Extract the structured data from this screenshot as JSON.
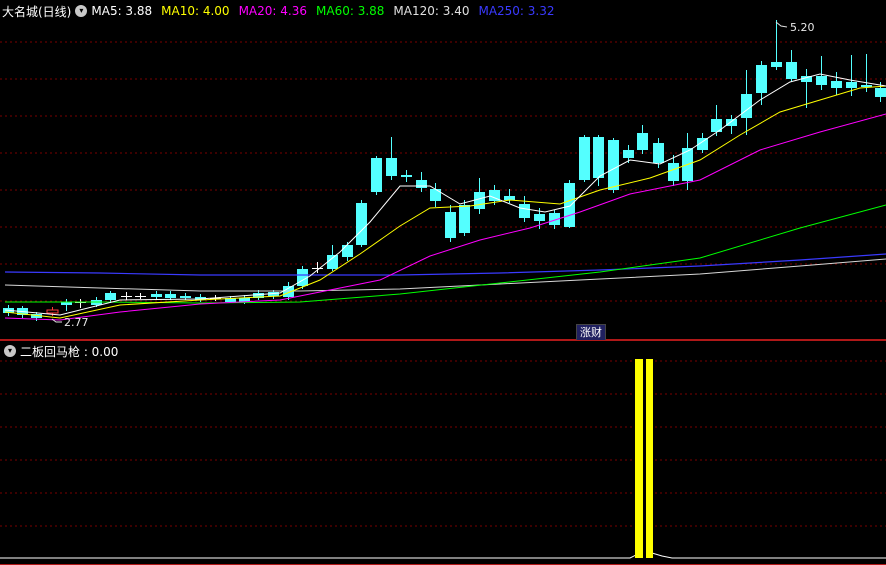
{
  "main": {
    "title": "大名城(日线)",
    "ma": [
      {
        "label": "MA5: 3.88",
        "color": "#ffffff"
      },
      {
        "label": "MA10: 4.00",
        "color": "#ffff00"
      },
      {
        "label": "MA20: 4.36",
        "color": "#ff00ff"
      },
      {
        "label": "MA60: 3.88",
        "color": "#00ff00"
      },
      {
        "label": "MA120: 3.40",
        "color": "#e0e0e0"
      },
      {
        "label": "MA250: 3.32",
        "color": "#3a3aff"
      }
    ],
    "high_label": "5.20",
    "low_label": "2.77",
    "badge": "涨财"
  },
  "indicator": {
    "title": "二板回马枪 : 0.00",
    "colors": {
      "bar": "#ffff00",
      "line": "#ffffff"
    }
  },
  "colors": {
    "up": "#ff3a3a",
    "down": "#54ffff",
    "grid": "#7a0000",
    "border": "#b01818"
  }
}
